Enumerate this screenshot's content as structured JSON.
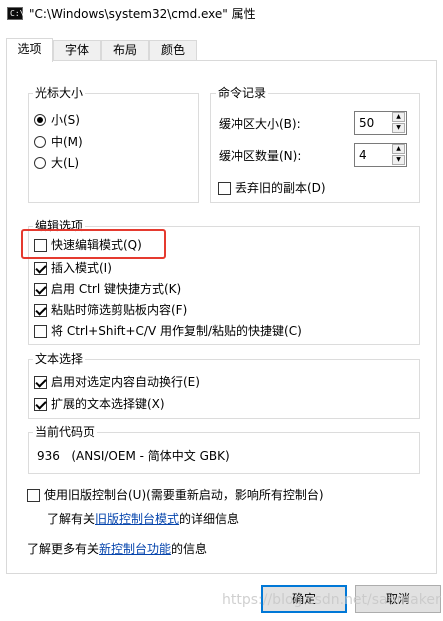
{
  "window": {
    "title": "\"C:\\Windows\\system32\\cmd.exe\" 属性",
    "icon_label": "C:\\"
  },
  "tabs": [
    {
      "label": "选项",
      "active": true
    },
    {
      "label": "字体",
      "active": false
    },
    {
      "label": "布局",
      "active": false
    },
    {
      "label": "颜色",
      "active": false
    }
  ],
  "cursor_size": {
    "title": "光标大小",
    "options": [
      {
        "label": "小(S)",
        "selected": true
      },
      {
        "label": "中(M)",
        "selected": false
      },
      {
        "label": "大(L)",
        "selected": false
      }
    ]
  },
  "command_history": {
    "title": "命令记录",
    "buffer_size_label": "缓冲区大小(B):",
    "buffer_size_value": "50",
    "buffer_count_label": "缓冲区数量(N):",
    "buffer_count_value": "4",
    "discard_old_label": "丢弃旧的副本(D)",
    "discard_old_checked": false
  },
  "edit_options": {
    "title": "编辑选项",
    "items": [
      {
        "label": "快速编辑模式(Q)",
        "checked": false
      },
      {
        "label": "插入模式(I)",
        "checked": true
      },
      {
        "label": "启用 Ctrl 键快捷方式(K)",
        "checked": true
      },
      {
        "label": "粘贴时筛选剪贴板内容(F)",
        "checked": true
      },
      {
        "label": "将 Ctrl+Shift+C/V 用作复制/粘贴的快捷键(C)",
        "checked": false
      }
    ]
  },
  "text_selection": {
    "title": "文本选择",
    "items": [
      {
        "label": "启用对选定内容自动换行(E)",
        "checked": true
      },
      {
        "label": "扩展的文本选择键(X)",
        "checked": true
      }
    ]
  },
  "code_page": {
    "title": "当前代码页",
    "value": "936   (ANSI/OEM - 简体中文 GBK)"
  },
  "legacy": {
    "checkbox_label": "使用旧版控制台(U)(需要重新启动，影响所有控制台)",
    "checked": false,
    "learn_prefix": "了解有关",
    "learn_link": "旧版控制台模式",
    "learn_suffix": "的详细信息"
  },
  "more_info": {
    "prefix": "了解更多有关",
    "link": "新控制台功能",
    "suffix": "的信息"
  },
  "buttons": {
    "ok": "确定",
    "cancel": "取消"
  },
  "watermark": "https://blog.csdn.net/sanmaker",
  "colors": {
    "highlight_box": "#e53a2f",
    "link": "#0645ad",
    "default_button_border": "#0078d7"
  }
}
